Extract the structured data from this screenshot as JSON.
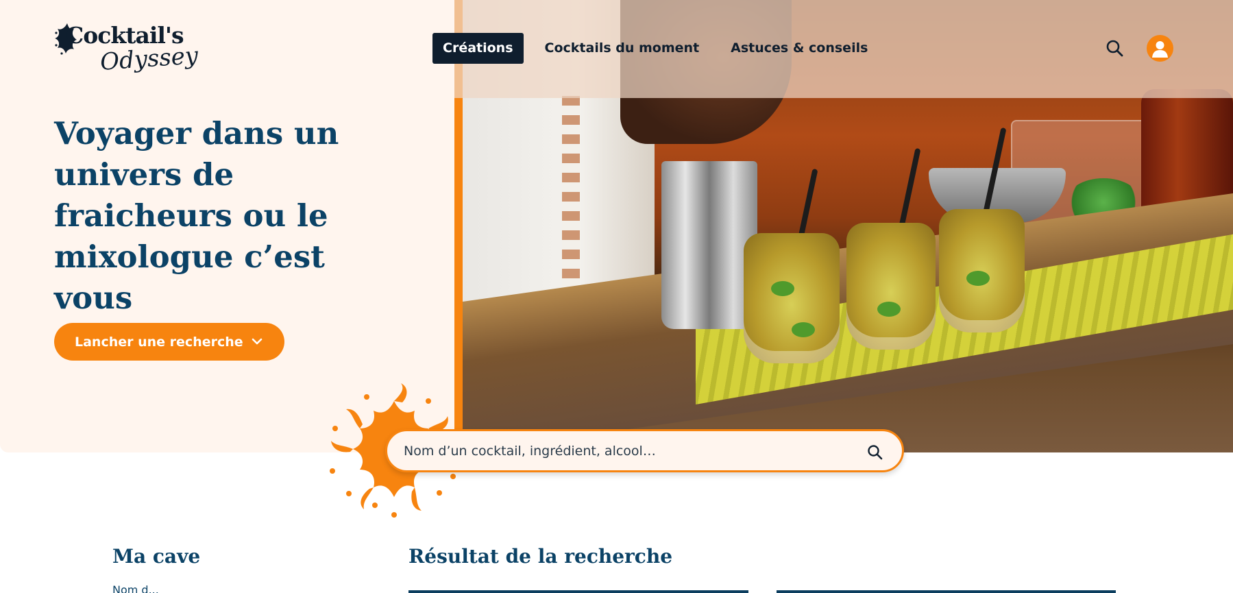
{
  "logo": {
    "line1": "Cocktail's",
    "line2": "Odyssey"
  },
  "nav": {
    "items": [
      {
        "label": "Créations",
        "active": true
      },
      {
        "label": "Cocktails du moment",
        "active": false
      },
      {
        "label": "Astuces & conseils",
        "active": false
      }
    ]
  },
  "header": {
    "search_icon": "search-icon",
    "avatar_icon": "user-icon"
  },
  "hero": {
    "title": "Voyager dans un univers de fraicheurs ou le mixologue c’est vous",
    "cta_label": "Lancher une recherche",
    "cta_icon": "chevron-down-icon"
  },
  "search": {
    "placeholder": "Nom d’un cocktail, ingrédient, alcool…"
  },
  "sections": {
    "cave_title": "Ma cave",
    "cave_sub": "Nom d...",
    "results_title": "Résultat de la recherche"
  },
  "colors": {
    "accent": "#f7840f",
    "navy": "#0b4266",
    "dark": "#0f1e2e",
    "cream": "#fff5ee"
  }
}
